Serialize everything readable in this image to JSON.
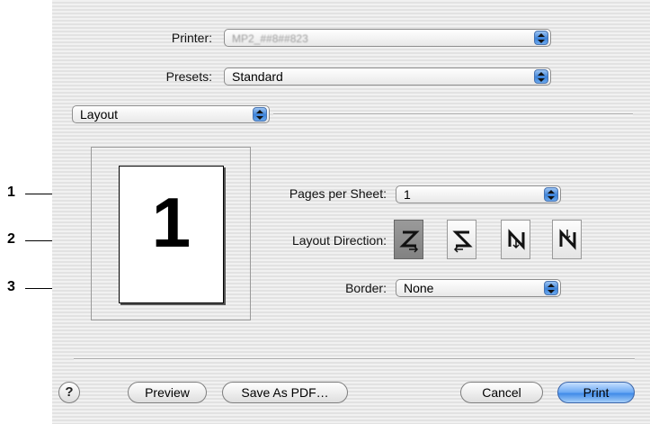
{
  "printer": {
    "label": "Printer:",
    "value": "MP2_##8##823"
  },
  "presets": {
    "label": "Presets:",
    "value": "Standard"
  },
  "section": {
    "value": "Layout"
  },
  "preview": {
    "page_number": "1"
  },
  "layout": {
    "pages_per_sheet_label": "Pages per Sheet:",
    "pages_per_sheet_value": "1",
    "layout_direction_label": "Layout Direction:",
    "layout_direction_options": [
      "Z",
      "reverse-S",
      "N-down",
      "N"
    ],
    "layout_direction_selected": "Z",
    "border_label": "Border:",
    "border_value": "None"
  },
  "callouts": [
    "1",
    "2",
    "3"
  ],
  "buttons": {
    "help": "?",
    "preview": "Preview",
    "save_pdf": "Save As PDF…",
    "cancel": "Cancel",
    "print": "Print"
  },
  "colors": {
    "accent": "#3f8ae8",
    "background": "#ededed"
  }
}
